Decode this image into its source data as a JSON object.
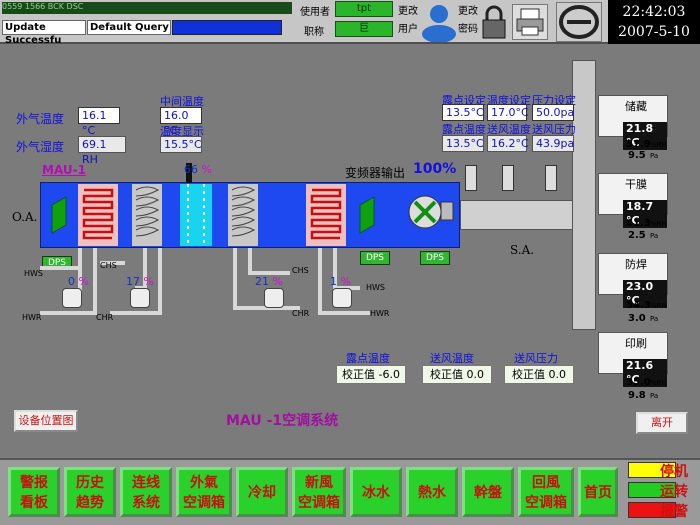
{
  "header": {
    "status_strip": "0559          1566          BCK          DSC",
    "status_message": "Update Successfu",
    "query_label": "Default Query",
    "user_label": "使用者",
    "user_value": "tpt",
    "role_label": "职称",
    "role_value": "巨",
    "change_user": [
      "更改",
      "用户"
    ],
    "change_password": [
      "更改",
      "密码"
    ],
    "time": "22:42:03",
    "date": "2007-5-10"
  },
  "outside": {
    "temp_label": "外气温度",
    "temp_value": "16.1 °C",
    "humidity_label": "外气湿度",
    "humidity_value": "69.1 RH"
  },
  "middle_temp": {
    "label": "中间温度",
    "value": "16.0 °C",
    "display_label": "温度显示",
    "display_value": "15.5°C"
  },
  "mau_label": "MAU-1",
  "oa_label": "O.A.",
  "sa_label": "S.A.",
  "spray_pct": "66",
  "inverter": {
    "label": "变频器输出",
    "value": "100%"
  },
  "setpoints": {
    "dew_set_label": "露点设定",
    "temp_set_label": "温度设定",
    "pressure_set_label": "压力设定",
    "dew_set": "13.5°C",
    "temp_set": "17.0°C",
    "pressure_set": "50.0pa",
    "dew_label": "露点温度",
    "supply_temp_label": "送风温度",
    "supply_pressure_label": "送风压力",
    "dew_value": "13.5°C",
    "supply_temp": "16.2°C",
    "supply_pressure": "43.9pa"
  },
  "dps_label": "DPS",
  "valves": {
    "hws": "HWS",
    "hwr": "HWR",
    "chs": "CHS",
    "chr": "CHR",
    "v1": "0",
    "v2": "17",
    "v3": "21",
    "v4": "1",
    "pct": "%"
  },
  "rooms": [
    {
      "name": "储藏",
      "temp": "21.8 °C",
      "rh": "57.9",
      "pa": "9.5"
    },
    {
      "name": "干膜",
      "temp": "18.7 °C",
      "rh": "61.3",
      "pa": "2.5"
    },
    {
      "name": "防焊",
      "temp": "23.0 °C",
      "rh": "54.3",
      "pa": "3.0"
    },
    {
      "name": "印刷",
      "temp": "21.6 °C",
      "rh": "55.0",
      "pa": "9.8"
    }
  ],
  "units": {
    "rh": "%RH",
    "pa": "Pa"
  },
  "corrections": {
    "dew_title": "露点温度",
    "temp_title": "送风温度",
    "pressure_title": "送风压力",
    "dew": "校正值  -6.0",
    "temp": "校正值  0.0",
    "pressure": "校正值  0.0"
  },
  "location_button": "设备位置图",
  "system_title": "MAU  -1空调系统",
  "exit_button": "离开",
  "nav": [
    [
      "警报",
      "看板"
    ],
    [
      "历史",
      "趋势"
    ],
    [
      "连线",
      "系统"
    ],
    [
      "外氣",
      "空调箱"
    ],
    [
      "冷却",
      ""
    ],
    [
      "新風",
      "空调箱"
    ],
    [
      "冰水",
      ""
    ],
    [
      "熱水",
      ""
    ],
    [
      "幹盤",
      ""
    ],
    [
      "回風",
      "空调箱"
    ],
    [
      "首页",
      ""
    ]
  ],
  "legend": [
    {
      "label": "停机",
      "color": "#ffff00"
    },
    {
      "label": "运转",
      "color": "#22cc22"
    },
    {
      "label": "报警",
      "color": "#ee1111"
    }
  ],
  "colors": {
    "duct": "#1f49f0",
    "background": "#7b7b7b",
    "nav": "#2ad12a"
  }
}
